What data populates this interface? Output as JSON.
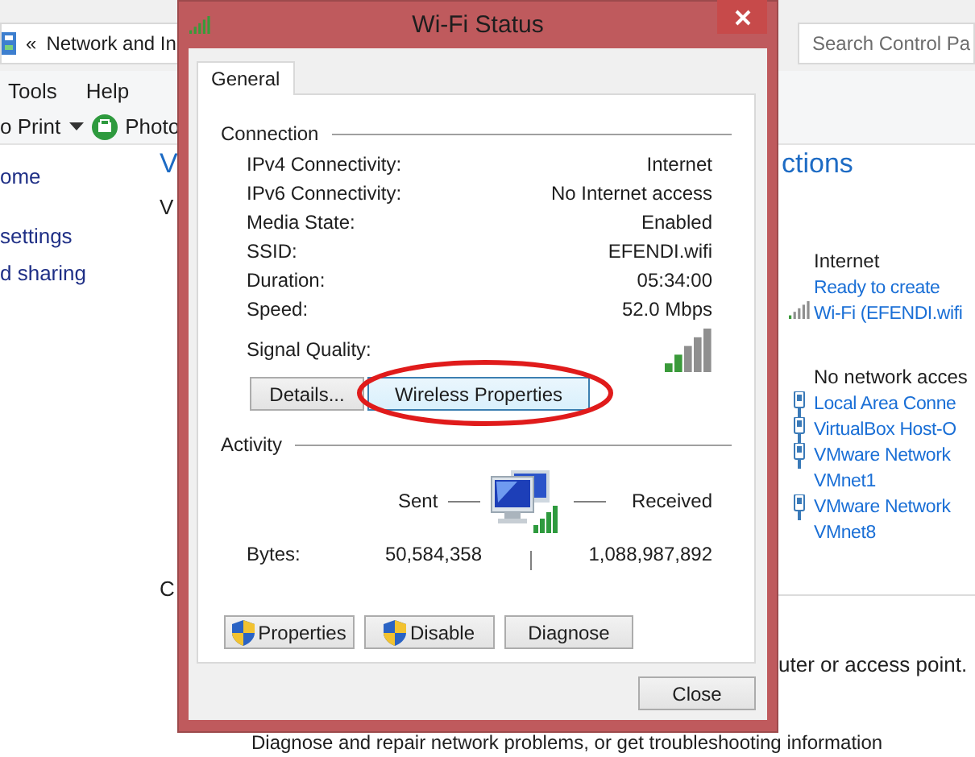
{
  "explorer": {
    "address": {
      "chevron": "«",
      "path": "Network and In"
    },
    "search": {
      "placeholder": "Search Control Pa"
    },
    "menu": [
      "Tools",
      "Help"
    ],
    "toolbar": {
      "print": "o Print",
      "photo": "Photo"
    },
    "nav_links": [
      "ome",
      "settings",
      "d sharing"
    ],
    "fragments": {
      "heading": "V",
      "line": "V",
      "section": "C"
    },
    "actions_heading": "ctions",
    "access_type": "Internet",
    "access_link": "Ready to create",
    "wifi_link": "Wi-Fi (EFENDI.wifi",
    "no_access": "No network acces",
    "adapters": [
      {
        "lines": [
          "Local Area Conne"
        ]
      },
      {
        "lines": [
          "VirtualBox Host-O"
        ]
      },
      {
        "lines": [
          "VMware Network",
          "VMnet1"
        ]
      },
      {
        "lines": [
          "VMware Network",
          "VMnet8"
        ]
      }
    ],
    "fragment_text": "uter or access point.",
    "troubleshoot": "Diagnose and repair network problems, or get troubleshooting information"
  },
  "dialog": {
    "title": "Wi-Fi Status",
    "tabs": [
      {
        "label": "General",
        "selected": true
      }
    ],
    "connection": {
      "heading": "Connection",
      "rows": [
        {
          "label": "IPv4 Connectivity:",
          "value": "Internet"
        },
        {
          "label": "IPv6 Connectivity:",
          "value": "No Internet access"
        },
        {
          "label": "Media State:",
          "value": "Enabled"
        },
        {
          "label": "SSID:",
          "value": "EFENDI.wifi"
        },
        {
          "label": "Duration:",
          "value": "05:34:00"
        },
        {
          "label": "Speed:",
          "value": "52.0 Mbps"
        }
      ],
      "signal_label": "Signal Quality:"
    },
    "buttons_top": [
      {
        "label": "Details...",
        "focused": false,
        "circled": false
      },
      {
        "label": "Wireless Properties",
        "focused": true,
        "circled": true
      }
    ],
    "activity": {
      "heading": "Activity",
      "sent": "Sent",
      "received": "Received",
      "bytes_label": "Bytes:",
      "bytes_sent": "50,584,358",
      "bytes_received": "1,088,987,892"
    },
    "actions": [
      {
        "label": "Properties",
        "shield": true
      },
      {
        "label": "Disable",
        "shield": true
      },
      {
        "label": "Diagnose",
        "shield": false
      }
    ],
    "close_button": "Close"
  }
}
